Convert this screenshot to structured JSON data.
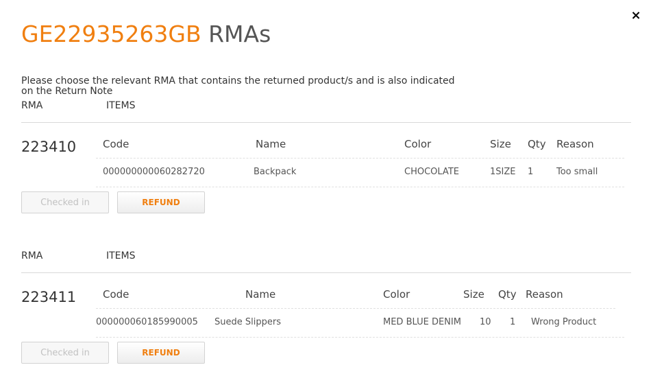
{
  "modal": {
    "close_icon": "×",
    "title_order": "GE22935263GB",
    "title_suffix": "RMAs",
    "instructions": "Please choose the relevant RMA that contains the returned product/s and is also indicated on the Return Note"
  },
  "colors": {
    "accent": "#f07f10",
    "text": "#333333",
    "muted": "#555555",
    "border": "#d9d9d9"
  },
  "table_headers": {
    "rma": "RMA",
    "items": "ITEMS",
    "code": "Code",
    "name": "Name",
    "color": "Color",
    "size": "Size",
    "qty": "Qty",
    "reason": "Reason"
  },
  "rmas": [
    {
      "number": "223410",
      "items": [
        {
          "code": "000000000060282720",
          "name": "Backpack",
          "color": "CHOCOLATE",
          "size": "1SIZE",
          "qty": "1",
          "reason": "Too small"
        }
      ],
      "checked_in_label": "Checked in",
      "refund_label": "REFUND"
    },
    {
      "number": "223411",
      "items": [
        {
          "code": "000000060185990005",
          "name": "Suede Slippers",
          "color": "MED BLUE DENIM",
          "size": "10",
          "qty": "1",
          "reason": "Wrong Product"
        }
      ],
      "checked_in_label": "Checked in",
      "refund_label": "REFUND"
    }
  ]
}
